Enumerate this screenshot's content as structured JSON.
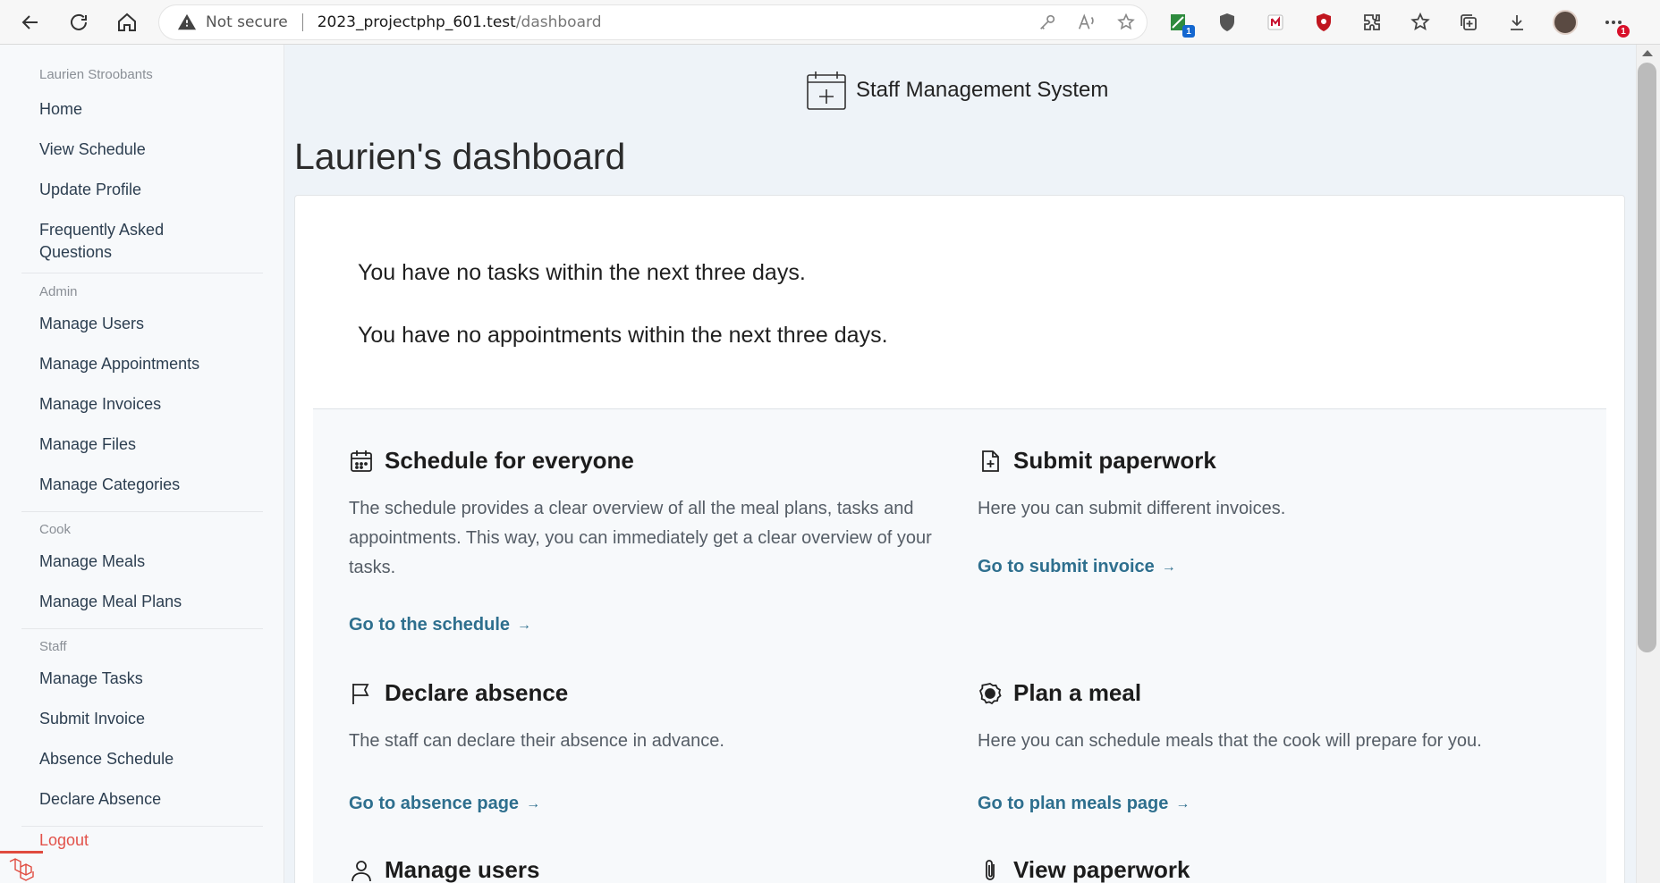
{
  "browser": {
    "not_secure": "Not secure",
    "url_host": "2023_projectphp_601.test",
    "url_path": "/dashboard",
    "ext_badge": "1",
    "download_badge": "1"
  },
  "sidebar": {
    "user_name": "Laurien Stroobants",
    "items_main": [
      "Home",
      "View Schedule",
      "Update Profile",
      "Frequently Asked Questions"
    ],
    "section_admin": "Admin",
    "items_admin": [
      "Manage Users",
      "Manage Appointments",
      "Manage Invoices",
      "Manage Files",
      "Manage Categories"
    ],
    "section_cook": "Cook",
    "items_cook": [
      "Manage Meals",
      "Manage Meal Plans"
    ],
    "section_staff": "Staff",
    "items_staff": [
      "Manage Tasks",
      "Submit Invoice",
      "Absence Schedule",
      "Declare Absence"
    ],
    "logout": "Logout"
  },
  "header": {
    "brand": "Staff Management System",
    "title": "Laurien's dashboard"
  },
  "notices": {
    "tasks": "You have no tasks within the next three days.",
    "appointments": "You have no appointments within the next three days."
  },
  "tiles": {
    "schedule": {
      "title": "Schedule for everyone",
      "desc": "The schedule provides a clear overview of all the meal plans, tasks and appointments. This way, you can immediately get a clear overview of your tasks.",
      "link": "Go to the schedule"
    },
    "paperwork": {
      "title": "Submit paperwork",
      "desc": "Here you can submit different invoices.",
      "link": "Go to submit invoice"
    },
    "absence": {
      "title": "Declare absence",
      "desc": "The staff can declare their absence in advance.",
      "link": "Go to absence page"
    },
    "meal": {
      "title": "Plan a meal",
      "desc": "Here you can schedule meals that the cook will prepare for you.",
      "link": "Go to plan meals page"
    },
    "users": {
      "title": "Manage users"
    },
    "view_paperwork": {
      "title": "View paperwork"
    }
  },
  "colors": {
    "link": "#2e6f8e",
    "logout": "#e2524a",
    "main_bg": "#eef3f8"
  }
}
